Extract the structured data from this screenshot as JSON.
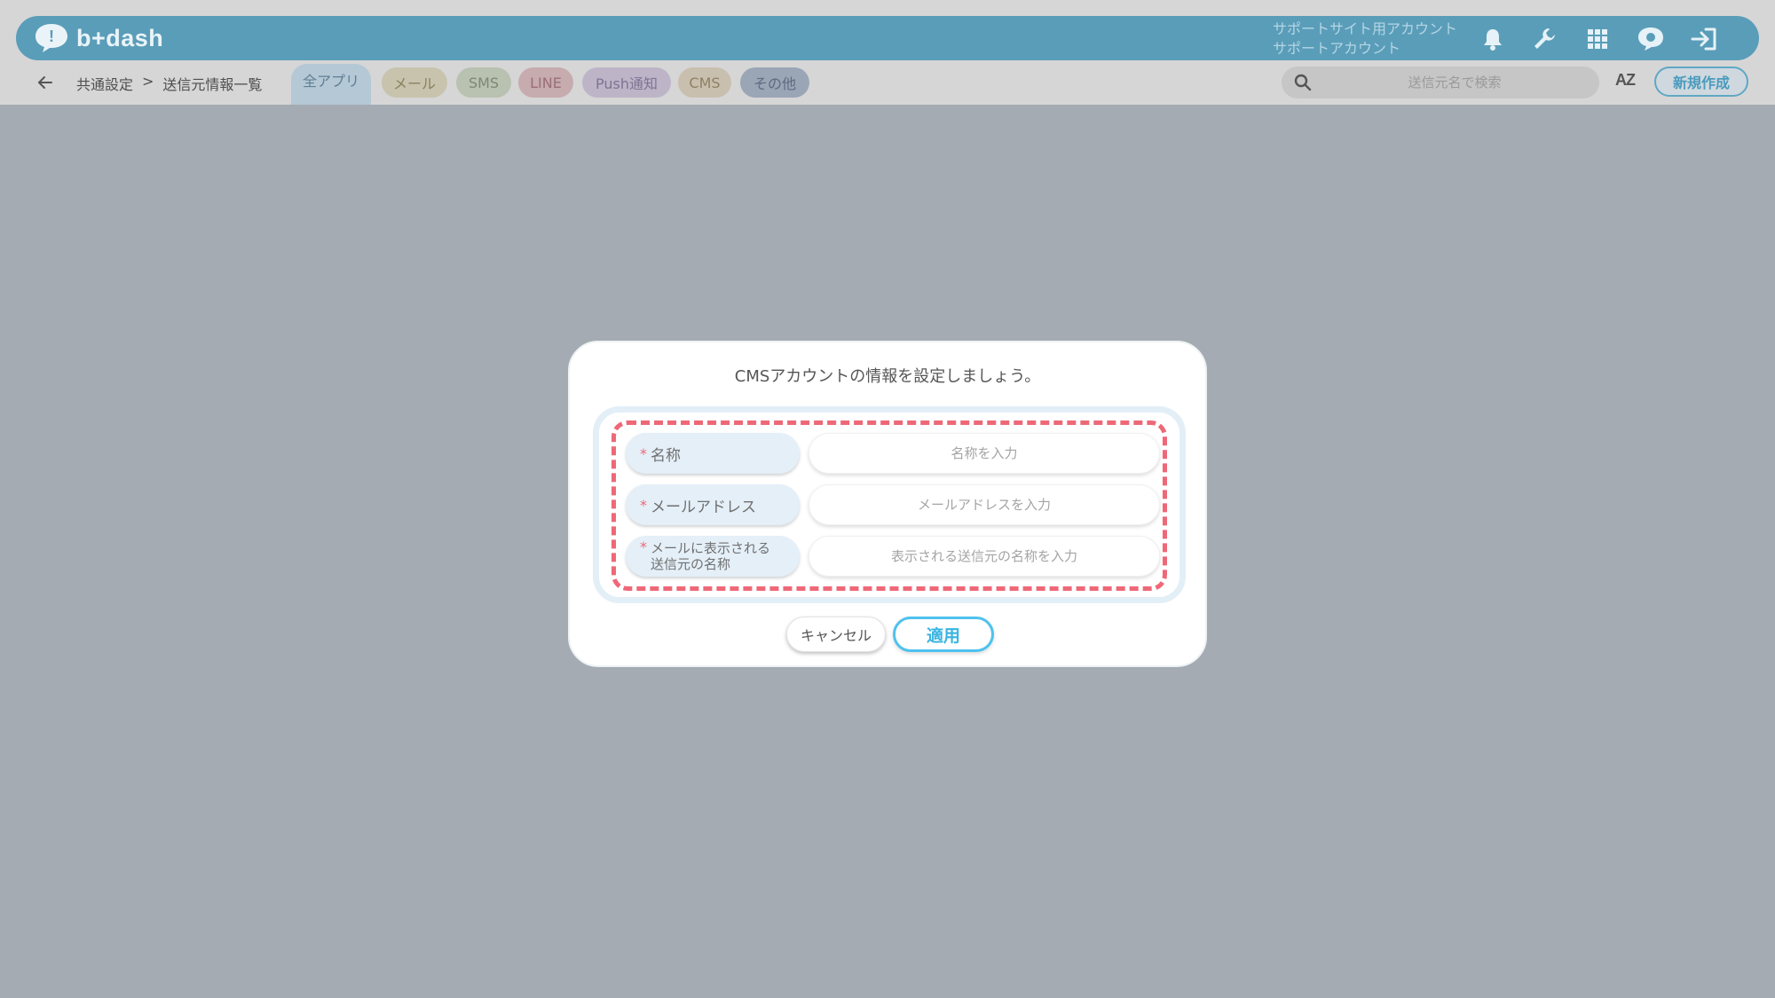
{
  "app": {
    "logo_text": "b+dash"
  },
  "account": {
    "line1": "サポートサイト用アカウント",
    "line2": "サポートアカウント"
  },
  "header_icons": [
    "bell-icon",
    "wrench-icon",
    "apps-grid-icon",
    "chat-badge-icon",
    "logout-icon"
  ],
  "breadcrumb": {
    "parent": "共通設定",
    "separator": ">",
    "current": "送信元情報一覧"
  },
  "tabs": [
    {
      "label": "全アプリ",
      "active": true,
      "bg": "#b4c8d6",
      "color": "#617e92"
    },
    {
      "label": "メール",
      "bg": "#c8c3ac",
      "color": "#8a8160"
    },
    {
      "label": "SMS",
      "bg": "#b9c1b0",
      "color": "#7c8872"
    },
    {
      "label": "LINE",
      "bg": "#c6abaf",
      "color": "#9a6e75"
    },
    {
      "label": "Push通知",
      "bg": "#bdb5c7",
      "color": "#7f7394"
    },
    {
      "label": "CMS",
      "bg": "#c9bfae",
      "color": "#8e8064"
    },
    {
      "label": "その他",
      "bg": "#9aa6b6",
      "color": "#5d6a80"
    }
  ],
  "search": {
    "placeholder": "送信元名で検索"
  },
  "sort": {
    "label": "AZ"
  },
  "new_button": {
    "label": "新規作成"
  },
  "modal": {
    "title": "CMSアカウントの情報を設定しましょう。",
    "fields": [
      {
        "label": "名称",
        "required_mark": "*",
        "placeholder": "名称を入力"
      },
      {
        "label": "メールアドレス",
        "required_mark": "*",
        "placeholder": "メールアドレスを入力"
      },
      {
        "label_line1": "メールに表示される",
        "label_line2": "送信元の名称",
        "required_mark": "*",
        "placeholder": "表示される送信元の名称を入力"
      }
    ],
    "cancel_label": "キャンセル",
    "apply_label": "適用"
  },
  "colors": {
    "brand": "#5a9db9",
    "accent": "#4ec2ee",
    "required": "#ee6877"
  }
}
